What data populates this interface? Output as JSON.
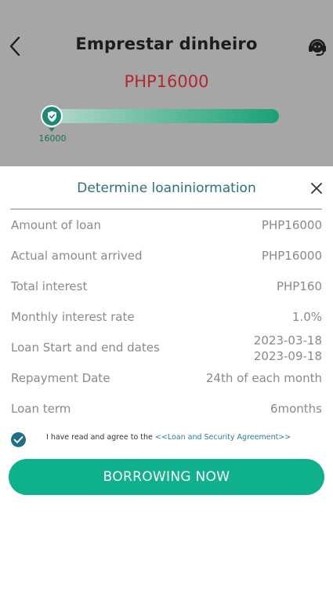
{
  "header": {
    "title": "Emprestar dinheiro",
    "amount": "PHP16000",
    "back_icon": "chevron-left-icon",
    "support_icon": "headset-icon"
  },
  "slider": {
    "value_label": "16000",
    "level_fraction": 0.0
  },
  "sheet": {
    "title": "Determine loaniniormation",
    "close_icon": "close-icon",
    "rows": [
      {
        "label": "Amount of loan",
        "value": "PHP16000"
      },
      {
        "label": "Actual amount arrived",
        "value": "PHP16000"
      },
      {
        "label": "Total interest",
        "value": "PHP160"
      },
      {
        "label": "Monthly interest rate",
        "value": "1.0%"
      },
      {
        "label": "Loan Start and end dates",
        "value_start": "2023-03-18",
        "value_end": "2023-09-18"
      },
      {
        "label": "Repayment Date",
        "value": "24th of each month"
      },
      {
        "label": "Loan term",
        "value": "6months"
      }
    ],
    "agreement": {
      "text": "I have read and agree to the",
      "link": "<<Loan and Security Agreement>>",
      "checked": true
    },
    "cta_label": "BORROWING NOW"
  },
  "colors": {
    "backdrop": "#a6a6a6",
    "amount_red": "#b3282b",
    "accent_green": "#0fb08c",
    "sheet_title": "#2f6f82",
    "label_gray": "#8a8a8a"
  }
}
